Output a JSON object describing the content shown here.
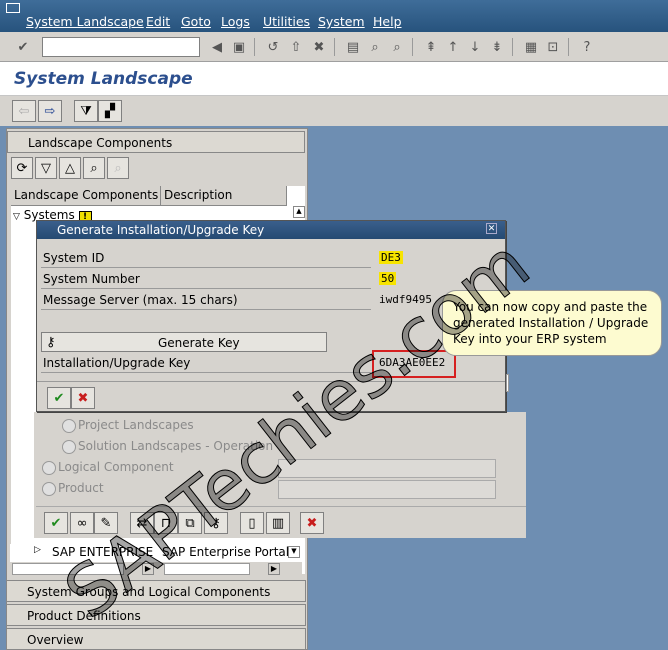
{
  "menubar": {
    "items": [
      "System Landscape",
      "Edit",
      "Goto",
      "Logs",
      "Utilities",
      "System",
      "Help"
    ]
  },
  "title": "System Landscape",
  "left": {
    "panel_header": "Landscape Components",
    "columns": [
      "Landscape Components",
      "Description"
    ],
    "rows": [
      {
        "name": "Systems",
        "desc": ""
      },
      {
        "name": "SAP ENTERPRISE",
        "desc": "SAP Enterprise Portal"
      }
    ],
    "sections": [
      "System Groups and Logical Components",
      "Product Definitions",
      "Overview"
    ]
  },
  "dialog": {
    "title": "Generate Installation/Upgrade Key",
    "fields": [
      {
        "label": "System ID",
        "value": "DE3"
      },
      {
        "label": "System Number",
        "value": "50"
      },
      {
        "label": "Message Server (max. 15 chars)",
        "value": "iwdf9495"
      }
    ],
    "generate_label": "Generate Key",
    "key_label": "Installation/Upgrade Key",
    "key_value": "6DA3AE0EE2"
  },
  "callout": "You can now copy and paste the generated Installation / Upgrade Key into your ERP system",
  "backform": {
    "radios": [
      "Project Landscapes",
      "Solution Landscapes - Operation",
      "Logical Component",
      "Product"
    ]
  },
  "watermark": "SAPTechies.com"
}
